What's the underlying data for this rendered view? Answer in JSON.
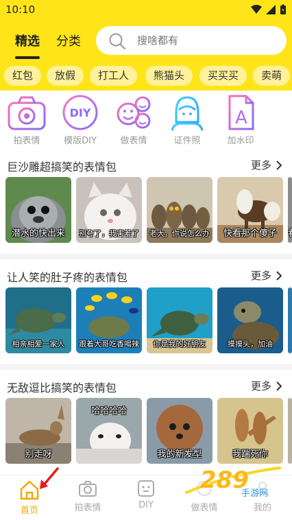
{
  "status": {
    "time": "10:10"
  },
  "tabs": [
    {
      "label": "精选"
    },
    {
      "label": "分类"
    }
  ],
  "search": {
    "placeholder": "搜啥都有"
  },
  "chips": [
    "红包",
    "放假",
    "打工人",
    "熊猫头",
    "买买买",
    "卖萌"
  ],
  "features": [
    {
      "label": "拍表情",
      "icon": "camera-icon"
    },
    {
      "label": "模版DIY",
      "icon": "diy-icon"
    },
    {
      "label": "做表情",
      "icon": "emoji-faces-icon"
    },
    {
      "label": "证件照",
      "icon": "id-photo-icon"
    },
    {
      "label": "加水印",
      "icon": "watermark-doc-icon"
    }
  ],
  "sections": [
    {
      "title": "巨沙雕超搞笑的表情包",
      "more": "更多",
      "items": [
        "潜水的快出来",
        "别夸了，我害羞了",
        "老大，你说怎么办",
        "快看那个傻子",
        "看"
      ]
    },
    {
      "title": "让人笑的肚子疼的表情包",
      "more": "更多",
      "items": [
        "相亲相爱一家人",
        "跟着大哥吃香喝辣",
        "你是我的好朋友",
        "摸摸头，加油",
        ""
      ]
    },
    {
      "title": "无敌逗比搞笑的表情包",
      "more": "更多",
      "items": [
        "别走呀",
        "哈哈哈哈",
        "我的新发型",
        "我踹死你",
        ""
      ]
    }
  ],
  "bottomnav": [
    {
      "label": "首页",
      "icon": "home-icon",
      "active": true
    },
    {
      "label": "拍表情",
      "icon": "camera-icon"
    },
    {
      "label": "DIY",
      "icon": "diy-face-icon"
    },
    {
      "label": "做表情",
      "icon": "make-emoji-icon"
    },
    {
      "label": "我的",
      "icon": "profile-icon"
    }
  ],
  "watermark": {
    "text": "289",
    "sub": "手游网"
  },
  "colors": {
    "brand_yellow": "#ffe419",
    "chip_bg": "#fff29a",
    "active_nav": "#f5a600",
    "icon_purple": "#b46cf0"
  }
}
